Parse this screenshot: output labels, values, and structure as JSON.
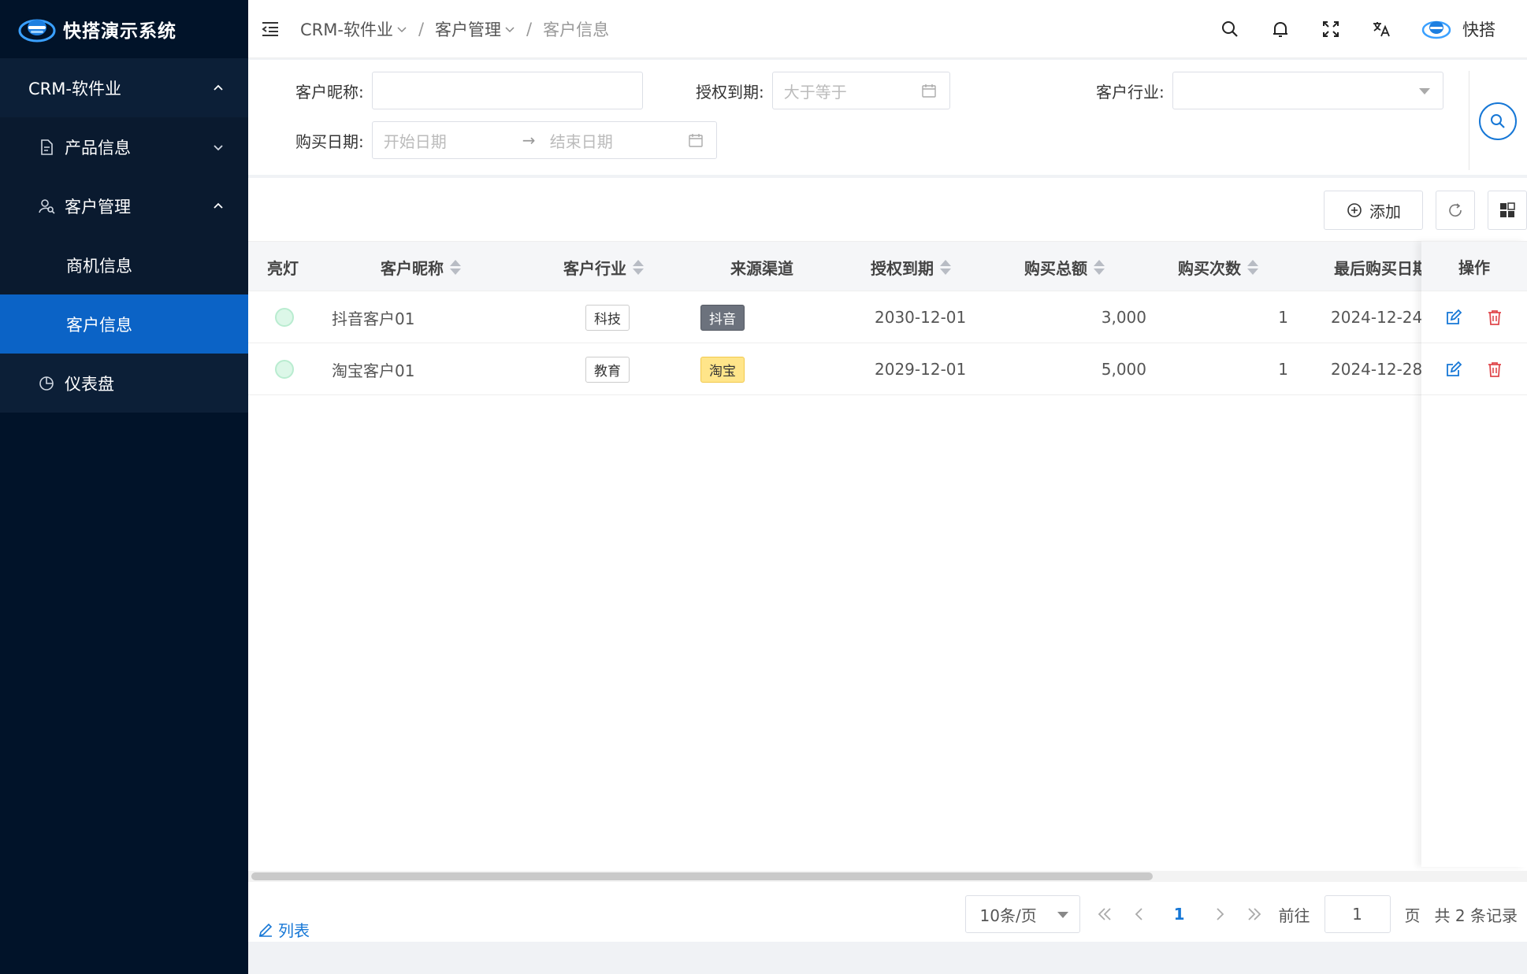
{
  "app": {
    "title": "快搭演示系统"
  },
  "sidebar": {
    "group": "CRM-软件业",
    "items": [
      {
        "label": "产品信息"
      },
      {
        "label": "客户管理",
        "children": [
          {
            "label": "商机信息"
          },
          {
            "label": "客户信息",
            "active": true
          }
        ]
      },
      {
        "label": "仪表盘"
      }
    ]
  },
  "header": {
    "breadcrumb": [
      "CRM-软件业",
      "客户管理",
      "客户信息"
    ],
    "user": "快搭"
  },
  "filters": {
    "nickname": {
      "label": "客户昵称:",
      "placeholder": ""
    },
    "auth_expire": {
      "label": "授权到期:",
      "placeholder": "大于等于"
    },
    "industry": {
      "label": "客户行业:",
      "placeholder": ""
    },
    "purchase_date": {
      "label": "购买日期:",
      "start_placeholder": "开始日期",
      "end_placeholder": "结束日期",
      "separator": "→"
    }
  },
  "toolbar": {
    "add_label": "添加"
  },
  "table": {
    "columns": [
      "亮灯",
      "客户昵称",
      "客户行业",
      "来源渠道",
      "授权到期",
      "购买总额",
      "购买次数",
      "最后购买日期",
      "操作"
    ],
    "rows": [
      {
        "name": "抖音客户01",
        "industry": "科技",
        "channel": "抖音",
        "expire": "2030-12-01",
        "total": "3,000",
        "count": "1",
        "last": "2024-12-24"
      },
      {
        "name": "淘宝客户01",
        "industry": "教育",
        "channel": "淘宝",
        "expire": "2029-12-01",
        "total": "5,000",
        "count": "1",
        "last": "2024-12-28"
      }
    ]
  },
  "footer": {
    "view_label": "列表",
    "page_size": "10条/页",
    "current_page": "1",
    "goto_label": "前往",
    "goto_value": "1",
    "page_unit": "页",
    "total_text": "共 2 条记录"
  },
  "colors": {
    "sidebar_bg": "#011329",
    "active": "#0b63c6",
    "primary": "#1677d6",
    "danger": "#e0474c"
  }
}
